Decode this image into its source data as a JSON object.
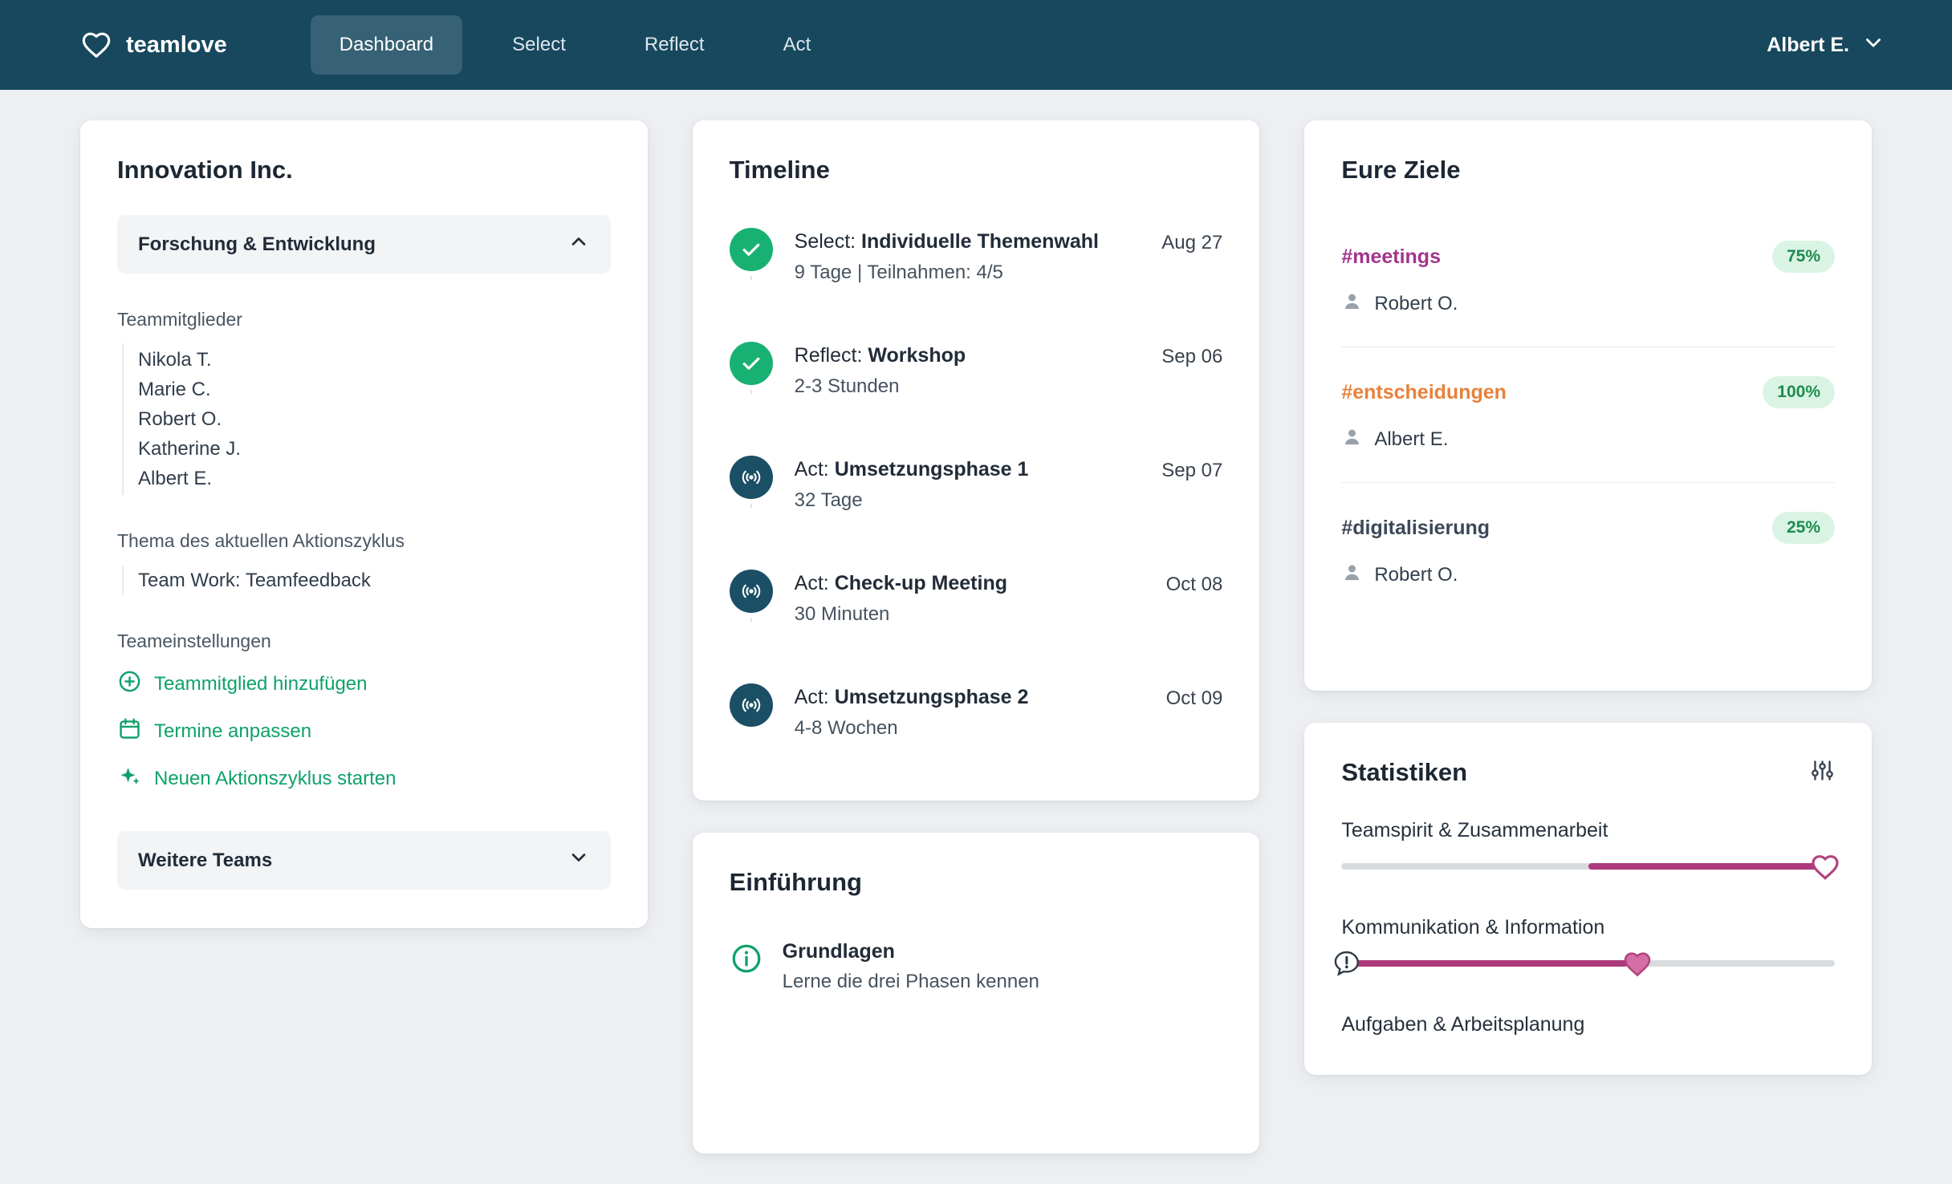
{
  "theme": {
    "navy": "#17485e",
    "green": "#10a16b",
    "badge_green_bg": "#d9f4e4",
    "badge_green_text": "#208a51",
    "magenta": "#ad3a7c"
  },
  "navbar": {
    "brand": "teamlove",
    "items": [
      {
        "label": "Dashboard",
        "active": true
      },
      {
        "label": "Select",
        "active": false
      },
      {
        "label": "Reflect",
        "active": false
      },
      {
        "label": "Act",
        "active": false
      }
    ],
    "user": "Albert E."
  },
  "team_card": {
    "title": "Innovation Inc.",
    "open_team": "Forschung & Entwicklung",
    "members_label": "Teammitglieder",
    "members": [
      "Nikola T.",
      "Marie C.",
      "Robert O.",
      "Katherine J.",
      "Albert E."
    ],
    "topic_label": "Thema des aktuellen Aktionszyklus",
    "topic": "Team Work: Teamfeedback",
    "settings_label": "Teameinstellungen",
    "actions": [
      {
        "label": "Teammitglied hinzufügen",
        "icon": "plus-circle-icon"
      },
      {
        "label": "Termine anpassen",
        "icon": "calendar-icon"
      },
      {
        "label": "Neuen Aktionszyklus starten",
        "icon": "sparkles-icon"
      }
    ],
    "more_teams": "Weitere Teams"
  },
  "timeline_card": {
    "title": "Timeline",
    "items": [
      {
        "phase": "Select:",
        "name": "Individuelle Themenwahl",
        "detail": "9 Tage | Teilnahmen: 4/5",
        "date": "Aug 27",
        "status": "done",
        "icon": "check"
      },
      {
        "phase": "Reflect:",
        "name": "Workshop",
        "detail": "2-3 Stunden",
        "date": "Sep 06",
        "status": "done",
        "icon": "check"
      },
      {
        "phase": "Act:",
        "name": "Umsetzungsphase 1",
        "detail": "32 Tage",
        "date": "Sep 07",
        "status": "act",
        "icon": "broadcast"
      },
      {
        "phase": "Act:",
        "name": "Check-up Meeting",
        "detail": "30 Minuten",
        "date": "Oct 08",
        "status": "act",
        "icon": "broadcast"
      },
      {
        "phase": "Act:",
        "name": "Umsetzungsphase 2",
        "detail": "4-8 Wochen",
        "date": "Oct 09",
        "status": "act",
        "icon": "broadcast"
      }
    ]
  },
  "intro_card": {
    "title": "Einführung",
    "items": [
      {
        "title": "Grundlagen",
        "subtitle": "Lerne die drei Phasen kennen"
      }
    ]
  },
  "goals_card": {
    "title": "Eure Ziele",
    "goals": [
      {
        "tag": "#meetings",
        "color": "#a2348c",
        "percent": "75%",
        "owner": "Robert O."
      },
      {
        "tag": "#entscheidungen",
        "color": "#e8813c",
        "percent": "100%",
        "owner": "Albert E."
      },
      {
        "tag": "#digitalisierung",
        "color": "#3c4858",
        "percent": "25%",
        "owner": "Robert O."
      }
    ]
  },
  "stats_card": {
    "title": "Statistiken",
    "sliders": [
      {
        "label": "Teamspirit & Zusammenarbeit",
        "fill_start": 50,
        "fill_end": 100,
        "thumb": 98,
        "thumb_style": "outline"
      },
      {
        "label": "Kommunikation & Information",
        "fill_start": 0,
        "fill_end": 58,
        "thumb": 60,
        "thumb_style": "filled",
        "icon": "exclamation-bubble-icon"
      },
      {
        "label": "Aufgaben & Arbeitsplanung"
      }
    ]
  }
}
